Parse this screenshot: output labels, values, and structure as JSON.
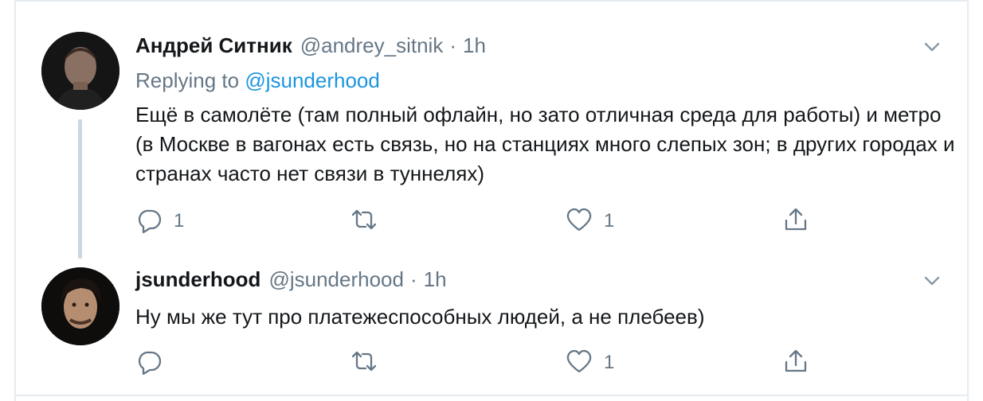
{
  "tweets": [
    {
      "name": "Андрей Ситник",
      "handle": "@andrey_sitnik",
      "time": "1h",
      "replying_label": "Replying to",
      "replying_to": "@jsunderhood",
      "text": "Ещё в самолёте (там полный офлайн, но зато отличная среда для работы) и метро (в Москве в вагонах есть связь, но на станциях много слепых зон; в других городах и странах часто нет связи в туннелях)",
      "reply_count": "1",
      "retweet_count": "",
      "like_count": "1",
      "avatar_color": "#2b2b2b"
    },
    {
      "name": "jsunderhood",
      "handle": "@jsunderhood",
      "time": "1h",
      "text": "Ну мы же тут про платежеспособных людей, а не плебеев)",
      "reply_count": "",
      "retweet_count": "",
      "like_count": "1",
      "avatar_color": "#1e1a16"
    }
  ],
  "separator": "·",
  "colors": {
    "text": "#14171a",
    "secondary": "#657786",
    "link": "#1b95e0",
    "border": "#e6ecf0",
    "thread_line": "#ccd6dd"
  },
  "icons": [
    "reply-icon",
    "retweet-icon",
    "like-icon",
    "share-icon",
    "chevron-down-icon"
  ]
}
